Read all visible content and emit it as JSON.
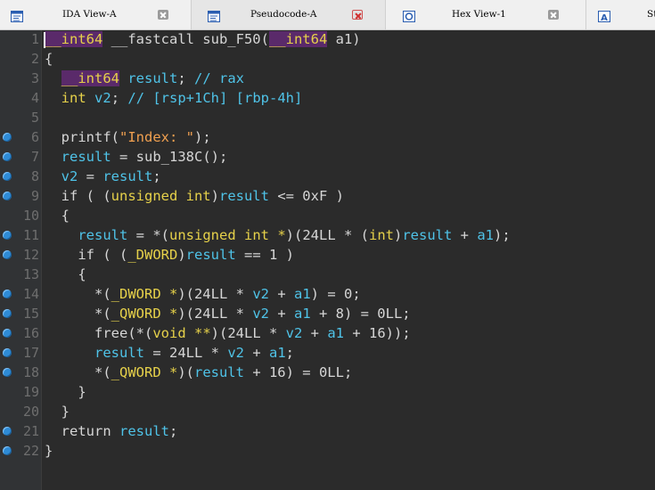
{
  "tabs": [
    {
      "label": "IDA View-A",
      "icon": "ida-view-icon",
      "close": "close-icon"
    },
    {
      "label": "Pseudocode-A",
      "icon": "pseudocode-icon",
      "close": "close-icon"
    },
    {
      "label": "Hex View-1",
      "icon": "hex-view-icon",
      "close": "close-icon"
    },
    {
      "label": "St",
      "icon": "structures-icon"
    }
  ],
  "editor": {
    "lines": [
      {
        "num": "1",
        "breakpoint": false,
        "segments": [
          {
            "t": "__int64",
            "c": "kw hl"
          },
          {
            "t": " __fastcall sub_F50(",
            "c": ""
          },
          {
            "t": "__int64",
            "c": "kw hl"
          },
          {
            "t": " a1)",
            "c": ""
          }
        ]
      },
      {
        "num": "2",
        "breakpoint": false,
        "segments": [
          {
            "t": "{",
            "c": ""
          }
        ]
      },
      {
        "num": "3",
        "breakpoint": false,
        "segments": [
          {
            "t": "  ",
            "c": ""
          },
          {
            "t": "__int64",
            "c": "kw hl"
          },
          {
            "t": " ",
            "c": ""
          },
          {
            "t": "result",
            "c": "var"
          },
          {
            "t": "; ",
            "c": ""
          },
          {
            "t": "// rax",
            "c": "cm"
          }
        ]
      },
      {
        "num": "4",
        "breakpoint": false,
        "segments": [
          {
            "t": "  ",
            "c": ""
          },
          {
            "t": "int",
            "c": "kw"
          },
          {
            "t": " ",
            "c": ""
          },
          {
            "t": "v2",
            "c": "var"
          },
          {
            "t": "; ",
            "c": ""
          },
          {
            "t": "// [rsp+1Ch] [rbp-4h]",
            "c": "cm"
          }
        ]
      },
      {
        "num": "5",
        "breakpoint": false,
        "segments": [
          {
            "t": "",
            "c": ""
          }
        ]
      },
      {
        "num": "6",
        "breakpoint": true,
        "segments": [
          {
            "t": "  printf(",
            "c": ""
          },
          {
            "t": "\"Index: \"",
            "c": "str"
          },
          {
            "t": ");",
            "c": ""
          }
        ]
      },
      {
        "num": "7",
        "breakpoint": true,
        "segments": [
          {
            "t": "  ",
            "c": ""
          },
          {
            "t": "result",
            "c": "var"
          },
          {
            "t": " = sub_138C();",
            "c": ""
          }
        ]
      },
      {
        "num": "8",
        "breakpoint": true,
        "segments": [
          {
            "t": "  ",
            "c": ""
          },
          {
            "t": "v2",
            "c": "var"
          },
          {
            "t": " = ",
            "c": ""
          },
          {
            "t": "result",
            "c": "var"
          },
          {
            "t": ";",
            "c": ""
          }
        ]
      },
      {
        "num": "9",
        "breakpoint": true,
        "segments": [
          {
            "t": "  if ( (",
            "c": ""
          },
          {
            "t": "unsigned int",
            "c": "kw"
          },
          {
            "t": ")",
            "c": ""
          },
          {
            "t": "result",
            "c": "var"
          },
          {
            "t": " <= 0xF )",
            "c": ""
          }
        ]
      },
      {
        "num": "10",
        "breakpoint": false,
        "segments": [
          {
            "t": "  {",
            "c": ""
          }
        ]
      },
      {
        "num": "11",
        "breakpoint": true,
        "segments": [
          {
            "t": "    ",
            "c": ""
          },
          {
            "t": "result",
            "c": "var"
          },
          {
            "t": " = *(",
            "c": ""
          },
          {
            "t": "unsigned int *",
            "c": "kw"
          },
          {
            "t": ")(24LL * (",
            "c": ""
          },
          {
            "t": "int",
            "c": "kw"
          },
          {
            "t": ")",
            "c": ""
          },
          {
            "t": "result",
            "c": "var"
          },
          {
            "t": " + ",
            "c": ""
          },
          {
            "t": "a1",
            "c": "var"
          },
          {
            "t": ");",
            "c": ""
          }
        ]
      },
      {
        "num": "12",
        "breakpoint": true,
        "segments": [
          {
            "t": "    if ( (",
            "c": ""
          },
          {
            "t": "_DWORD",
            "c": "kw"
          },
          {
            "t": ")",
            "c": ""
          },
          {
            "t": "result",
            "c": "var"
          },
          {
            "t": " == 1 )",
            "c": ""
          }
        ]
      },
      {
        "num": "13",
        "breakpoint": false,
        "segments": [
          {
            "t": "    {",
            "c": ""
          }
        ]
      },
      {
        "num": "14",
        "breakpoint": true,
        "segments": [
          {
            "t": "      *(",
            "c": ""
          },
          {
            "t": "_DWORD *",
            "c": "kw"
          },
          {
            "t": ")(24LL * ",
            "c": ""
          },
          {
            "t": "v2",
            "c": "var"
          },
          {
            "t": " + ",
            "c": ""
          },
          {
            "t": "a1",
            "c": "var"
          },
          {
            "t": ") = 0;",
            "c": ""
          }
        ]
      },
      {
        "num": "15",
        "breakpoint": true,
        "segments": [
          {
            "t": "      *(",
            "c": ""
          },
          {
            "t": "_QWORD *",
            "c": "kw"
          },
          {
            "t": ")(24LL * ",
            "c": ""
          },
          {
            "t": "v2",
            "c": "var"
          },
          {
            "t": " + ",
            "c": ""
          },
          {
            "t": "a1",
            "c": "var"
          },
          {
            "t": " + 8) = 0LL;",
            "c": ""
          }
        ]
      },
      {
        "num": "16",
        "breakpoint": true,
        "segments": [
          {
            "t": "      free(*(",
            "c": ""
          },
          {
            "t": "void **",
            "c": "kw"
          },
          {
            "t": ")(24LL * ",
            "c": ""
          },
          {
            "t": "v2",
            "c": "var"
          },
          {
            "t": " + ",
            "c": ""
          },
          {
            "t": "a1",
            "c": "var"
          },
          {
            "t": " + 16));",
            "c": ""
          }
        ]
      },
      {
        "num": "17",
        "breakpoint": true,
        "segments": [
          {
            "t": "      ",
            "c": ""
          },
          {
            "t": "result",
            "c": "var"
          },
          {
            "t": " = 24LL * ",
            "c": ""
          },
          {
            "t": "v2",
            "c": "var"
          },
          {
            "t": " + ",
            "c": ""
          },
          {
            "t": "a1",
            "c": "var"
          },
          {
            "t": ";",
            "c": ""
          }
        ]
      },
      {
        "num": "18",
        "breakpoint": true,
        "segments": [
          {
            "t": "      *(",
            "c": ""
          },
          {
            "t": "_QWORD *",
            "c": "kw"
          },
          {
            "t": ")(",
            "c": ""
          },
          {
            "t": "result",
            "c": "var"
          },
          {
            "t": " + 16) = 0LL;",
            "c": ""
          }
        ]
      },
      {
        "num": "19",
        "breakpoint": false,
        "segments": [
          {
            "t": "    }",
            "c": ""
          }
        ]
      },
      {
        "num": "20",
        "breakpoint": false,
        "segments": [
          {
            "t": "  }",
            "c": ""
          }
        ]
      },
      {
        "num": "21",
        "breakpoint": true,
        "segments": [
          {
            "t": "  return ",
            "c": ""
          },
          {
            "t": "result",
            "c": "var"
          },
          {
            "t": ";",
            "c": ""
          }
        ]
      },
      {
        "num": "22",
        "breakpoint": true,
        "segments": [
          {
            "t": "}",
            "c": ""
          }
        ]
      }
    ]
  }
}
